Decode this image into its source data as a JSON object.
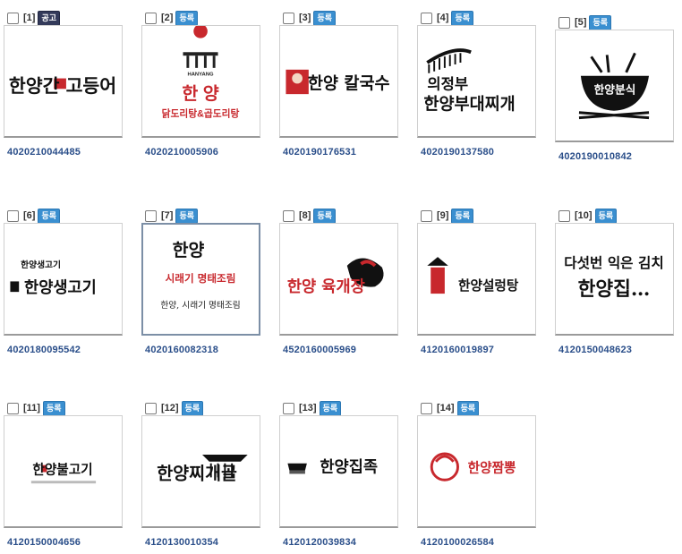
{
  "items": [
    {
      "index": "[1]",
      "badge": "공고",
      "badge_type": "ad",
      "number": "4020210044485",
      "logo": "한양간 고등어"
    },
    {
      "index": "[2]",
      "badge": "등록",
      "badge_type": "reg",
      "number": "4020210005906",
      "logo_brand": "HANYANG",
      "logo": "한 양",
      "logo_sub": "닭도리탕&곱도리탕"
    },
    {
      "index": "[3]",
      "badge": "등록",
      "badge_type": "reg",
      "number": "4020190176531",
      "logo": "한양 칼국수"
    },
    {
      "index": "[4]",
      "badge": "등록",
      "badge_type": "reg",
      "number": "4020190137580",
      "logo": "의정부",
      "logo_sub": "한양부대찌개"
    },
    {
      "index": "[5]",
      "badge": "등록",
      "badge_type": "reg",
      "number": "4020190010842",
      "logo": "한양분식"
    },
    {
      "index": "[6]",
      "badge": "등록",
      "badge_type": "reg",
      "number": "4020180095542",
      "logo_top": "한양생고기",
      "logo": "한양생고기"
    },
    {
      "index": "[7]",
      "badge": "등록",
      "badge_type": "reg",
      "number": "4020160082318",
      "logo": "한양",
      "logo_sub": "시래기 명태조림",
      "logo_foot": "한양, 시래기 명태조림"
    },
    {
      "index": "[8]",
      "badge": "등록",
      "badge_type": "reg",
      "number": "4520160005969",
      "logo": "한양 육개장"
    },
    {
      "index": "[9]",
      "badge": "등록",
      "badge_type": "reg",
      "number": "4120160019897",
      "logo": "한양설렁탕"
    },
    {
      "index": "[10]",
      "badge": "등록",
      "badge_type": "reg",
      "number": "4120150048623",
      "logo": "다섯번 익은 김치",
      "logo_sub": "한양집…"
    },
    {
      "index": "[11]",
      "badge": "등록",
      "badge_type": "reg",
      "number": "4120150004656",
      "logo": "한양불고기"
    },
    {
      "index": "[12]",
      "badge": "등록",
      "badge_type": "reg",
      "number": "4120130010354",
      "logo": "한양찌개골"
    },
    {
      "index": "[13]",
      "badge": "등록",
      "badge_type": "reg",
      "number": "4120120039834",
      "logo": "한양집족"
    },
    {
      "index": "[14]",
      "badge": "등록",
      "badge_type": "reg",
      "number": "4120100026584",
      "logo": "한양짬뽕"
    }
  ],
  "colors": {
    "badge_reg": "#3a8fd0",
    "badge_ad": "#333a5a",
    "number": "#2b4f8a",
    "accent_red": "#c8282d"
  }
}
